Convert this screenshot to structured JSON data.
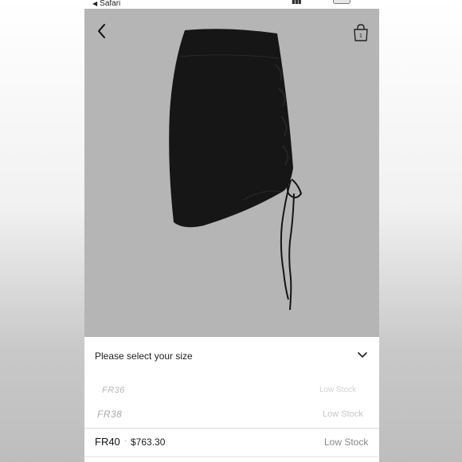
{
  "status_bar": {
    "browser_back_label": "Safari",
    "back_arrow": "◀"
  },
  "nav": {
    "back_icon": "chevron-left-icon",
    "bag_icon": "shopping-bag-icon",
    "bag_count": "1"
  },
  "size_selector": {
    "label": "Please select your size",
    "chevron_icon": "chevron-down-icon",
    "options": [
      {
        "size": "FR36",
        "stock": "Low Stock"
      },
      {
        "size": "FR38",
        "stock": "Low Stock"
      }
    ],
    "selected": {
      "size": "FR40",
      "separator": "·",
      "price": "$763.30",
      "stock": "Low Stock"
    }
  },
  "colors": {
    "photo_background": "#b5b5b5",
    "product": "#161616"
  }
}
